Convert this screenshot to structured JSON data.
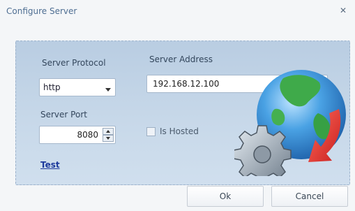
{
  "window": {
    "title": "Configure Server",
    "close_label": "✕"
  },
  "form": {
    "protocol_label": "Server Protocol",
    "protocol_value": "http",
    "address_label": "Server Address",
    "address_value": "192.168.12.100",
    "port_label": "Server Port",
    "port_value": "8080",
    "hosted_label": "Is Hosted",
    "hosted_checked": false,
    "test_label": "Test"
  },
  "buttons": {
    "ok_label": "Ok",
    "cancel_label": "Cancel"
  },
  "icons": {
    "illustration": "globe-gear-arrow-icon",
    "dropdown": "chevron-down-icon",
    "spin_up": "arrow-up-icon",
    "spin_down": "arrow-down-icon"
  },
  "colors": {
    "panel": "#c2d5e8",
    "link": "#1d3a9c",
    "arrow": "#e0302a",
    "globe": "#3a8fd6",
    "land": "#3faa4a"
  }
}
